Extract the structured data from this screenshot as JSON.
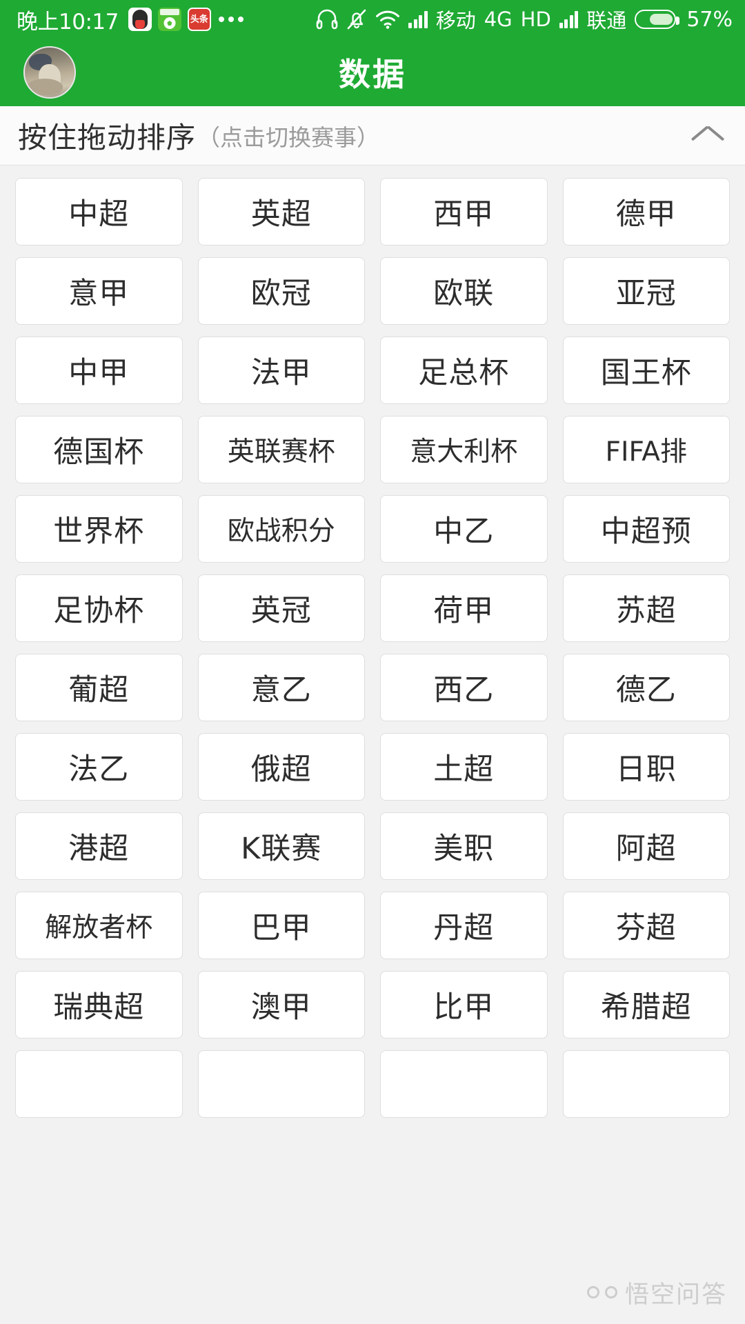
{
  "status_bar": {
    "time": "晚上10:17",
    "app_icons": [
      "qq-icon",
      "soccer-app-icon",
      "toutiao-icon"
    ],
    "overflow_indicator": "more-dots-icon",
    "icons": [
      "headset-icon",
      "bell-muted-icon",
      "wifi-icon",
      "signal-bars-icon"
    ],
    "carrier_1": "移动",
    "network": "4G",
    "hd": "HD",
    "carrier_2": "联通",
    "battery_percent": "57%",
    "background_color": "#1faa34"
  },
  "header": {
    "title": "数据",
    "avatar": "user-avatar",
    "background_color": "#1faa34",
    "title_color": "#ffffff"
  },
  "sort_bar": {
    "main_label": "按住拖动排序",
    "sub_label": "（点击切换赛事）",
    "collapse_icon": "chevron-up-icon"
  },
  "grid": {
    "tiles": [
      "中超",
      "英超",
      "西甲",
      "德甲",
      "意甲",
      "欧冠",
      "欧联",
      "亚冠",
      "中甲",
      "法甲",
      "足总杯",
      "国王杯",
      "德国杯",
      "英联赛杯",
      "意大利杯",
      "FIFA排",
      "世界杯",
      "欧战积分",
      "中乙",
      "中超预",
      "足协杯",
      "英冠",
      "荷甲",
      "苏超",
      "葡超",
      "意乙",
      "西乙",
      "德乙",
      "法乙",
      "俄超",
      "土超",
      "日职",
      "港超",
      "K联赛",
      "美职",
      "阿超",
      "解放者杯",
      "巴甲",
      "丹超",
      "芬超",
      "瑞典超",
      "澳甲",
      "比甲",
      "希腊超",
      "",
      "",
      "",
      ""
    ],
    "tile_bg": "#ffffff",
    "tile_border": "#dedede",
    "background_color": "#f2f2f2"
  },
  "watermark": {
    "text": "悟空问答",
    "logo": "wukong-logo-icon"
  }
}
